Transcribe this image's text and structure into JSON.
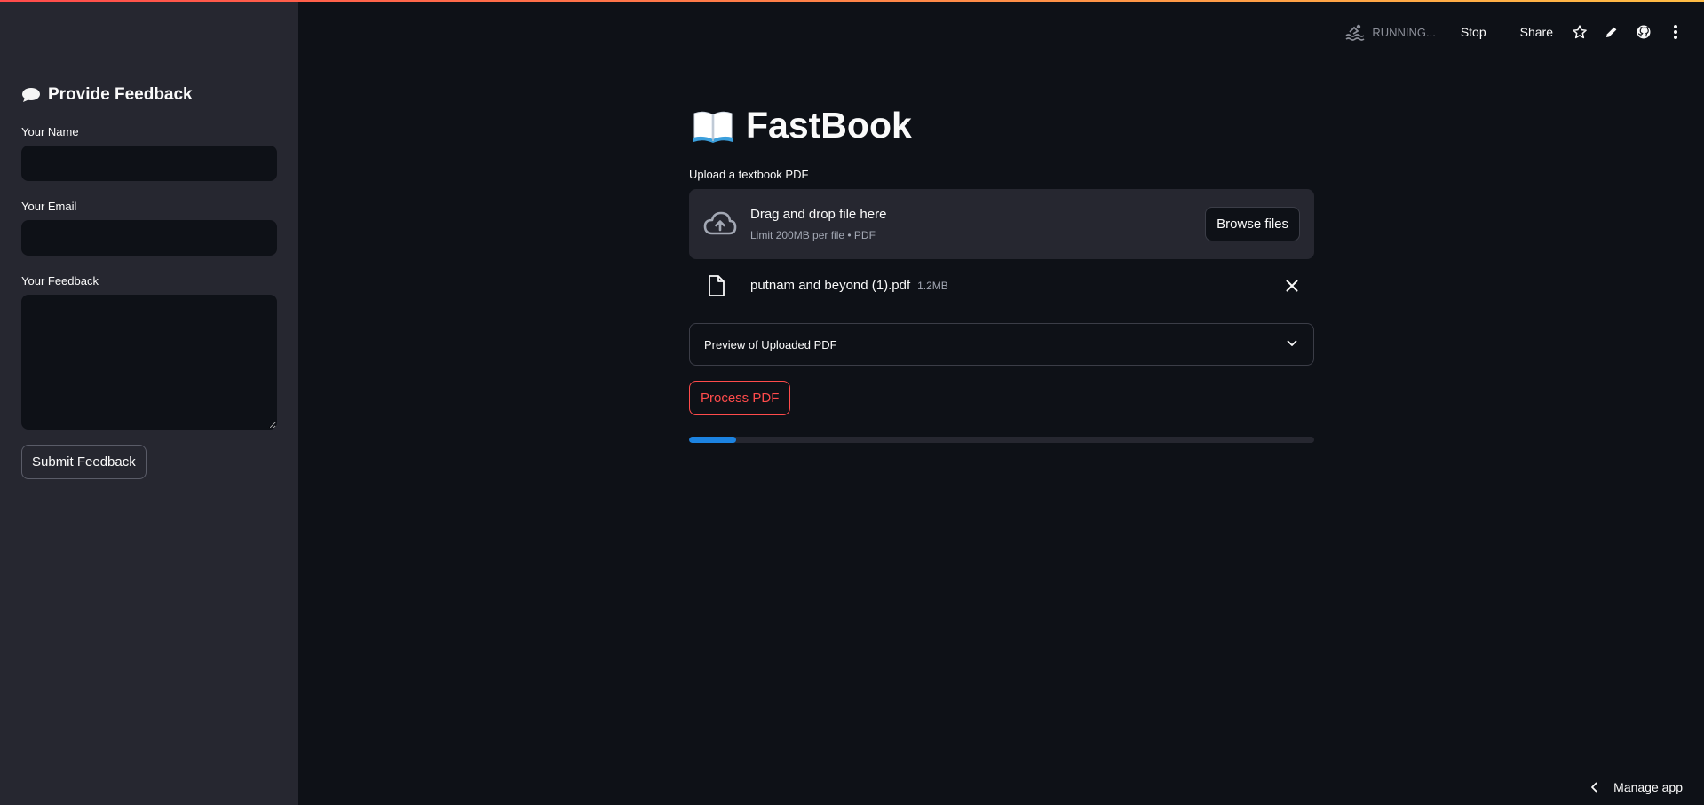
{
  "sidebar": {
    "header": "Provide Feedback",
    "header_icon": "speech-bubble-icon",
    "name_label": "Your Name",
    "name_value": "",
    "email_label": "Your Email",
    "email_value": "",
    "feedback_label": "Your Feedback",
    "feedback_value": "",
    "submit_label": "Submit Feedback"
  },
  "toolbar": {
    "status": "RUNNING...",
    "stop_label": "Stop",
    "share_label": "Share",
    "icons": [
      "swimmer-icon",
      "star-icon",
      "pencil-icon",
      "github-icon",
      "more-vertical-icon"
    ]
  },
  "main": {
    "title": "FastBook",
    "title_icon": "open-book-icon",
    "upload_label": "Upload a textbook PDF",
    "dropzone": {
      "title": "Drag and drop file here",
      "subtitle": "Limit 200MB per file • PDF",
      "browse_label": "Browse files"
    },
    "file": {
      "name": "putnam and beyond (1).pdf",
      "size": "1.2MB"
    },
    "expander_label": "Preview of Uploaded PDF",
    "process_label": "Process PDF",
    "progress": 0.075
  },
  "footer": {
    "manage_label": "Manage app"
  },
  "colors": {
    "background": "#0e1117",
    "sidebar": "#262730",
    "accent": "#ff4b4b",
    "progress": "#1c83e1"
  }
}
